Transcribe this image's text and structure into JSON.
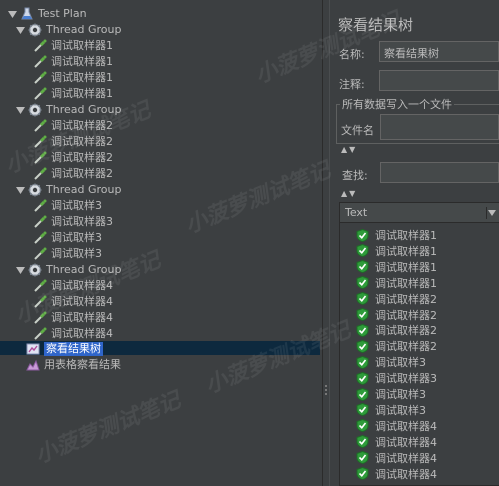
{
  "tree": {
    "root": {
      "label": "Test Plan",
      "icon": "flask-icon"
    },
    "groups": [
      {
        "label": "Thread Group",
        "samplers": [
          "调试取样器1",
          "调试取样器1",
          "调试取样器1",
          "调试取样器1"
        ]
      },
      {
        "label": "Thread Group",
        "samplers": [
          "调试取样器2",
          "调试取样器2",
          "调试取样器2",
          "调试取样器2"
        ]
      },
      {
        "label": "Thread Group",
        "samplers": [
          "调试取样3",
          "调试取样器3",
          "调试取样3",
          "调试取样3"
        ]
      },
      {
        "label": "Thread Group",
        "samplers": [
          "调试取样器4",
          "调试取样器4",
          "调试取样器4",
          "调试取样器4"
        ]
      }
    ],
    "listeners": [
      {
        "label": "察看结果树",
        "selected": true
      },
      {
        "label": "用表格察看结果",
        "selected": false
      }
    ]
  },
  "panel": {
    "title": "察看结果树",
    "name_label": "名称:",
    "name_value": "察看结果树",
    "comment_label": "注释:",
    "comment_value": "",
    "file_group_title": "所有数据写入一个文件",
    "filename_label": "文件名",
    "filename_value": "",
    "search_label": "查找:",
    "search_value": "",
    "table_header": "Text",
    "results": [
      "调试取样器1",
      "调试取样器1",
      "调试取样器1",
      "调试取样器1",
      "调试取样器2",
      "调试取样器2",
      "调试取样器2",
      "调试取样器2",
      "调试取样3",
      "调试取样器3",
      "调试取样3",
      "调试取样3",
      "调试取样器4",
      "调试取样器4",
      "调试取样器4",
      "调试取样器4"
    ]
  },
  "watermark": "小菠萝测试笔记",
  "colors": {
    "background": "#3c3f41",
    "selection": "#2f65ca",
    "check": "#2e9b3a",
    "text": "#bbbbbb"
  }
}
